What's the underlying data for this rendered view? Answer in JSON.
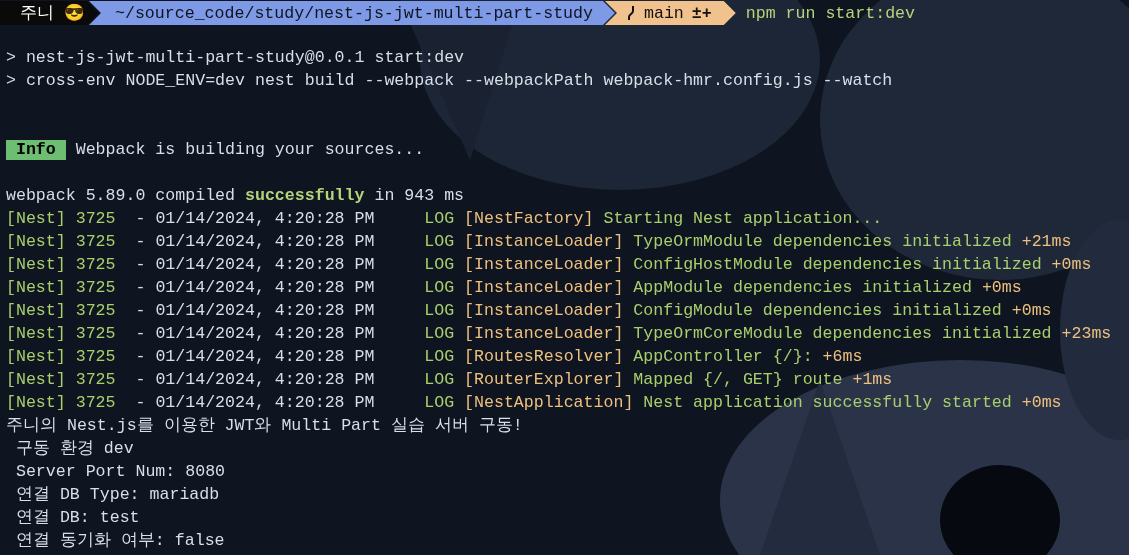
{
  "prompt": {
    "user": "주니",
    "emoji": "😎",
    "path": "~/source_code/study/nest-js-jwt-multi-part-study",
    "branch": "main",
    "branch_status": "±+",
    "command": "npm run start:dev"
  },
  "lines": [
    {
      "kind": "blank"
    },
    {
      "kind": "plain",
      "text": "> nest-js-jwt-multi-part-study@0.0.1 start:dev"
    },
    {
      "kind": "plain",
      "text": "> cross-env NODE_ENV=dev nest build --webpack --webpackPath webpack-hmr.config.js --watch"
    },
    {
      "kind": "blank"
    },
    {
      "kind": "blank"
    },
    {
      "kind": "info",
      "badge": "Info",
      "text": "Webpack is building your sources..."
    },
    {
      "kind": "blank"
    },
    {
      "kind": "compiled",
      "before": "webpack 5.89.0 compiled",
      "status": "successfully",
      "after": "in 943 ms"
    },
    {
      "kind": "log",
      "prefix": "[Nest]",
      "pid": "3725",
      "dash": "-",
      "timestamp": "01/14/2024, 4:20:28 PM",
      "level": "LOG",
      "context": "[NestFactory]",
      "message": "Starting Nest application..."
    },
    {
      "kind": "log",
      "prefix": "[Nest]",
      "pid": "3725",
      "dash": "-",
      "timestamp": "01/14/2024, 4:20:28 PM",
      "level": "LOG",
      "context": "[InstanceLoader]",
      "message": "TypeOrmModule dependencies initialized",
      "timing": "+21ms"
    },
    {
      "kind": "log",
      "prefix": "[Nest]",
      "pid": "3725",
      "dash": "-",
      "timestamp": "01/14/2024, 4:20:28 PM",
      "level": "LOG",
      "context": "[InstanceLoader]",
      "message": "ConfigHostModule dependencies initialized",
      "timing": "+0ms"
    },
    {
      "kind": "log",
      "prefix": "[Nest]",
      "pid": "3725",
      "dash": "-",
      "timestamp": "01/14/2024, 4:20:28 PM",
      "level": "LOG",
      "context": "[InstanceLoader]",
      "message": "AppModule dependencies initialized",
      "timing": "+0ms"
    },
    {
      "kind": "log",
      "prefix": "[Nest]",
      "pid": "3725",
      "dash": "-",
      "timestamp": "01/14/2024, 4:20:28 PM",
      "level": "LOG",
      "context": "[InstanceLoader]",
      "message": "ConfigModule dependencies initialized",
      "timing": "+0ms"
    },
    {
      "kind": "log",
      "prefix": "[Nest]",
      "pid": "3725",
      "dash": "-",
      "timestamp": "01/14/2024, 4:20:28 PM",
      "level": "LOG",
      "context": "[InstanceLoader]",
      "message": "TypeOrmCoreModule dependencies initialized",
      "timing": "+23ms"
    },
    {
      "kind": "log",
      "prefix": "[Nest]",
      "pid": "3725",
      "dash": "-",
      "timestamp": "01/14/2024, 4:20:28 PM",
      "level": "LOG",
      "context": "[RoutesResolver]",
      "message": "AppController {/}:",
      "timing": "+6ms"
    },
    {
      "kind": "log",
      "prefix": "[Nest]",
      "pid": "3725",
      "dash": "-",
      "timestamp": "01/14/2024, 4:20:28 PM",
      "level": "LOG",
      "context": "[RouterExplorer]",
      "message": "Mapped {/, GET} route",
      "timing": "+1ms"
    },
    {
      "kind": "log",
      "prefix": "[Nest]",
      "pid": "3725",
      "dash": "-",
      "timestamp": "01/14/2024, 4:20:28 PM",
      "level": "LOG",
      "context": "[NestApplication]",
      "message": "Nest application successfully started",
      "timing": "+0ms"
    },
    {
      "kind": "plain",
      "text": "주니의 Nest.js를 이용한 JWT와 Multi Part 실습 서버 구동!"
    },
    {
      "kind": "indented",
      "text": "구동 환경 dev"
    },
    {
      "kind": "indented",
      "text": "Server Port Num: 8080"
    },
    {
      "kind": "indented",
      "text": "연결 DB Type: mariadb"
    },
    {
      "kind": "indented",
      "text": "연결 DB: test"
    },
    {
      "kind": "indented",
      "text": "연결 동기화 여부: false"
    }
  ]
}
